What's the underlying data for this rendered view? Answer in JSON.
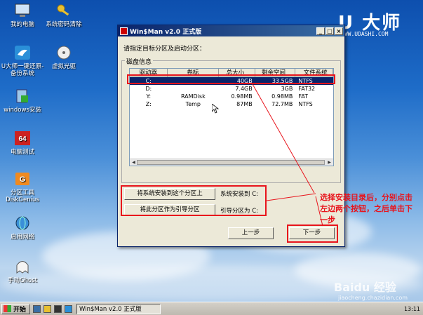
{
  "desktop": {
    "icons": [
      {
        "label": "我的电脑",
        "icon": "computer-icon"
      },
      {
        "label": "系统密码清除",
        "icon": "key-icon"
      },
      {
        "label": "U大师一键还原-备份系统",
        "icon": "bird-icon"
      },
      {
        "label": "虚拟光驱",
        "icon": "disc-icon"
      },
      {
        "label": "windows安装",
        "icon": "install-icon"
      },
      {
        "label": "电脑测试",
        "icon": "test64-icon"
      },
      {
        "label": "分区工具DiskGenius",
        "icon": "diskgenius-icon"
      },
      {
        "label": "启用网络",
        "icon": "network-icon"
      },
      {
        "label": "手动Ghost",
        "icon": "ghost-icon"
      }
    ],
    "brand": "U 大师",
    "brand_url": "WWW.UDASHI.COM"
  },
  "window": {
    "title": "Win$Man v2.0 正式版",
    "prompt": "请指定目标分区及启动分区：",
    "group_label": "磁盘信息",
    "columns": [
      "驱动器",
      "卷标",
      "总大小",
      "剩余空间",
      "文件系统"
    ],
    "rows": [
      [
        "C:",
        "",
        "40GB",
        "33.5GB",
        "NTFS"
      ],
      [
        "D:",
        "",
        "7.4GB",
        "3GB",
        "FAT32"
      ],
      [
        "Y:",
        "RAMDisk",
        "0.98MB",
        "0.98MB",
        "FAT"
      ],
      [
        "Z:",
        "Temp",
        "87MB",
        "72.7MB",
        "NTFS"
      ]
    ],
    "selected_row": 0,
    "install_button": "将系统安装到这个分区上",
    "install_status": "系统安装到 C:",
    "boot_button": "将此分区作为引导分区",
    "boot_status": "引导分区为 C:",
    "prev_button": "上一步",
    "next_button": "下一步"
  },
  "annotation": "选择安装目录后，分别点击左边两个按钮，之后单击下一步",
  "taskbar": {
    "start": "开始",
    "task": "Win$Man v2.0 正式版",
    "clock": "13:11"
  },
  "watermark": "Baidu 经验",
  "watermark2": "jiaocheng.chazidian.com",
  "colors": {
    "accent": "#e8141c",
    "selection": "#0a246a",
    "title_bar": "#0a246a"
  }
}
